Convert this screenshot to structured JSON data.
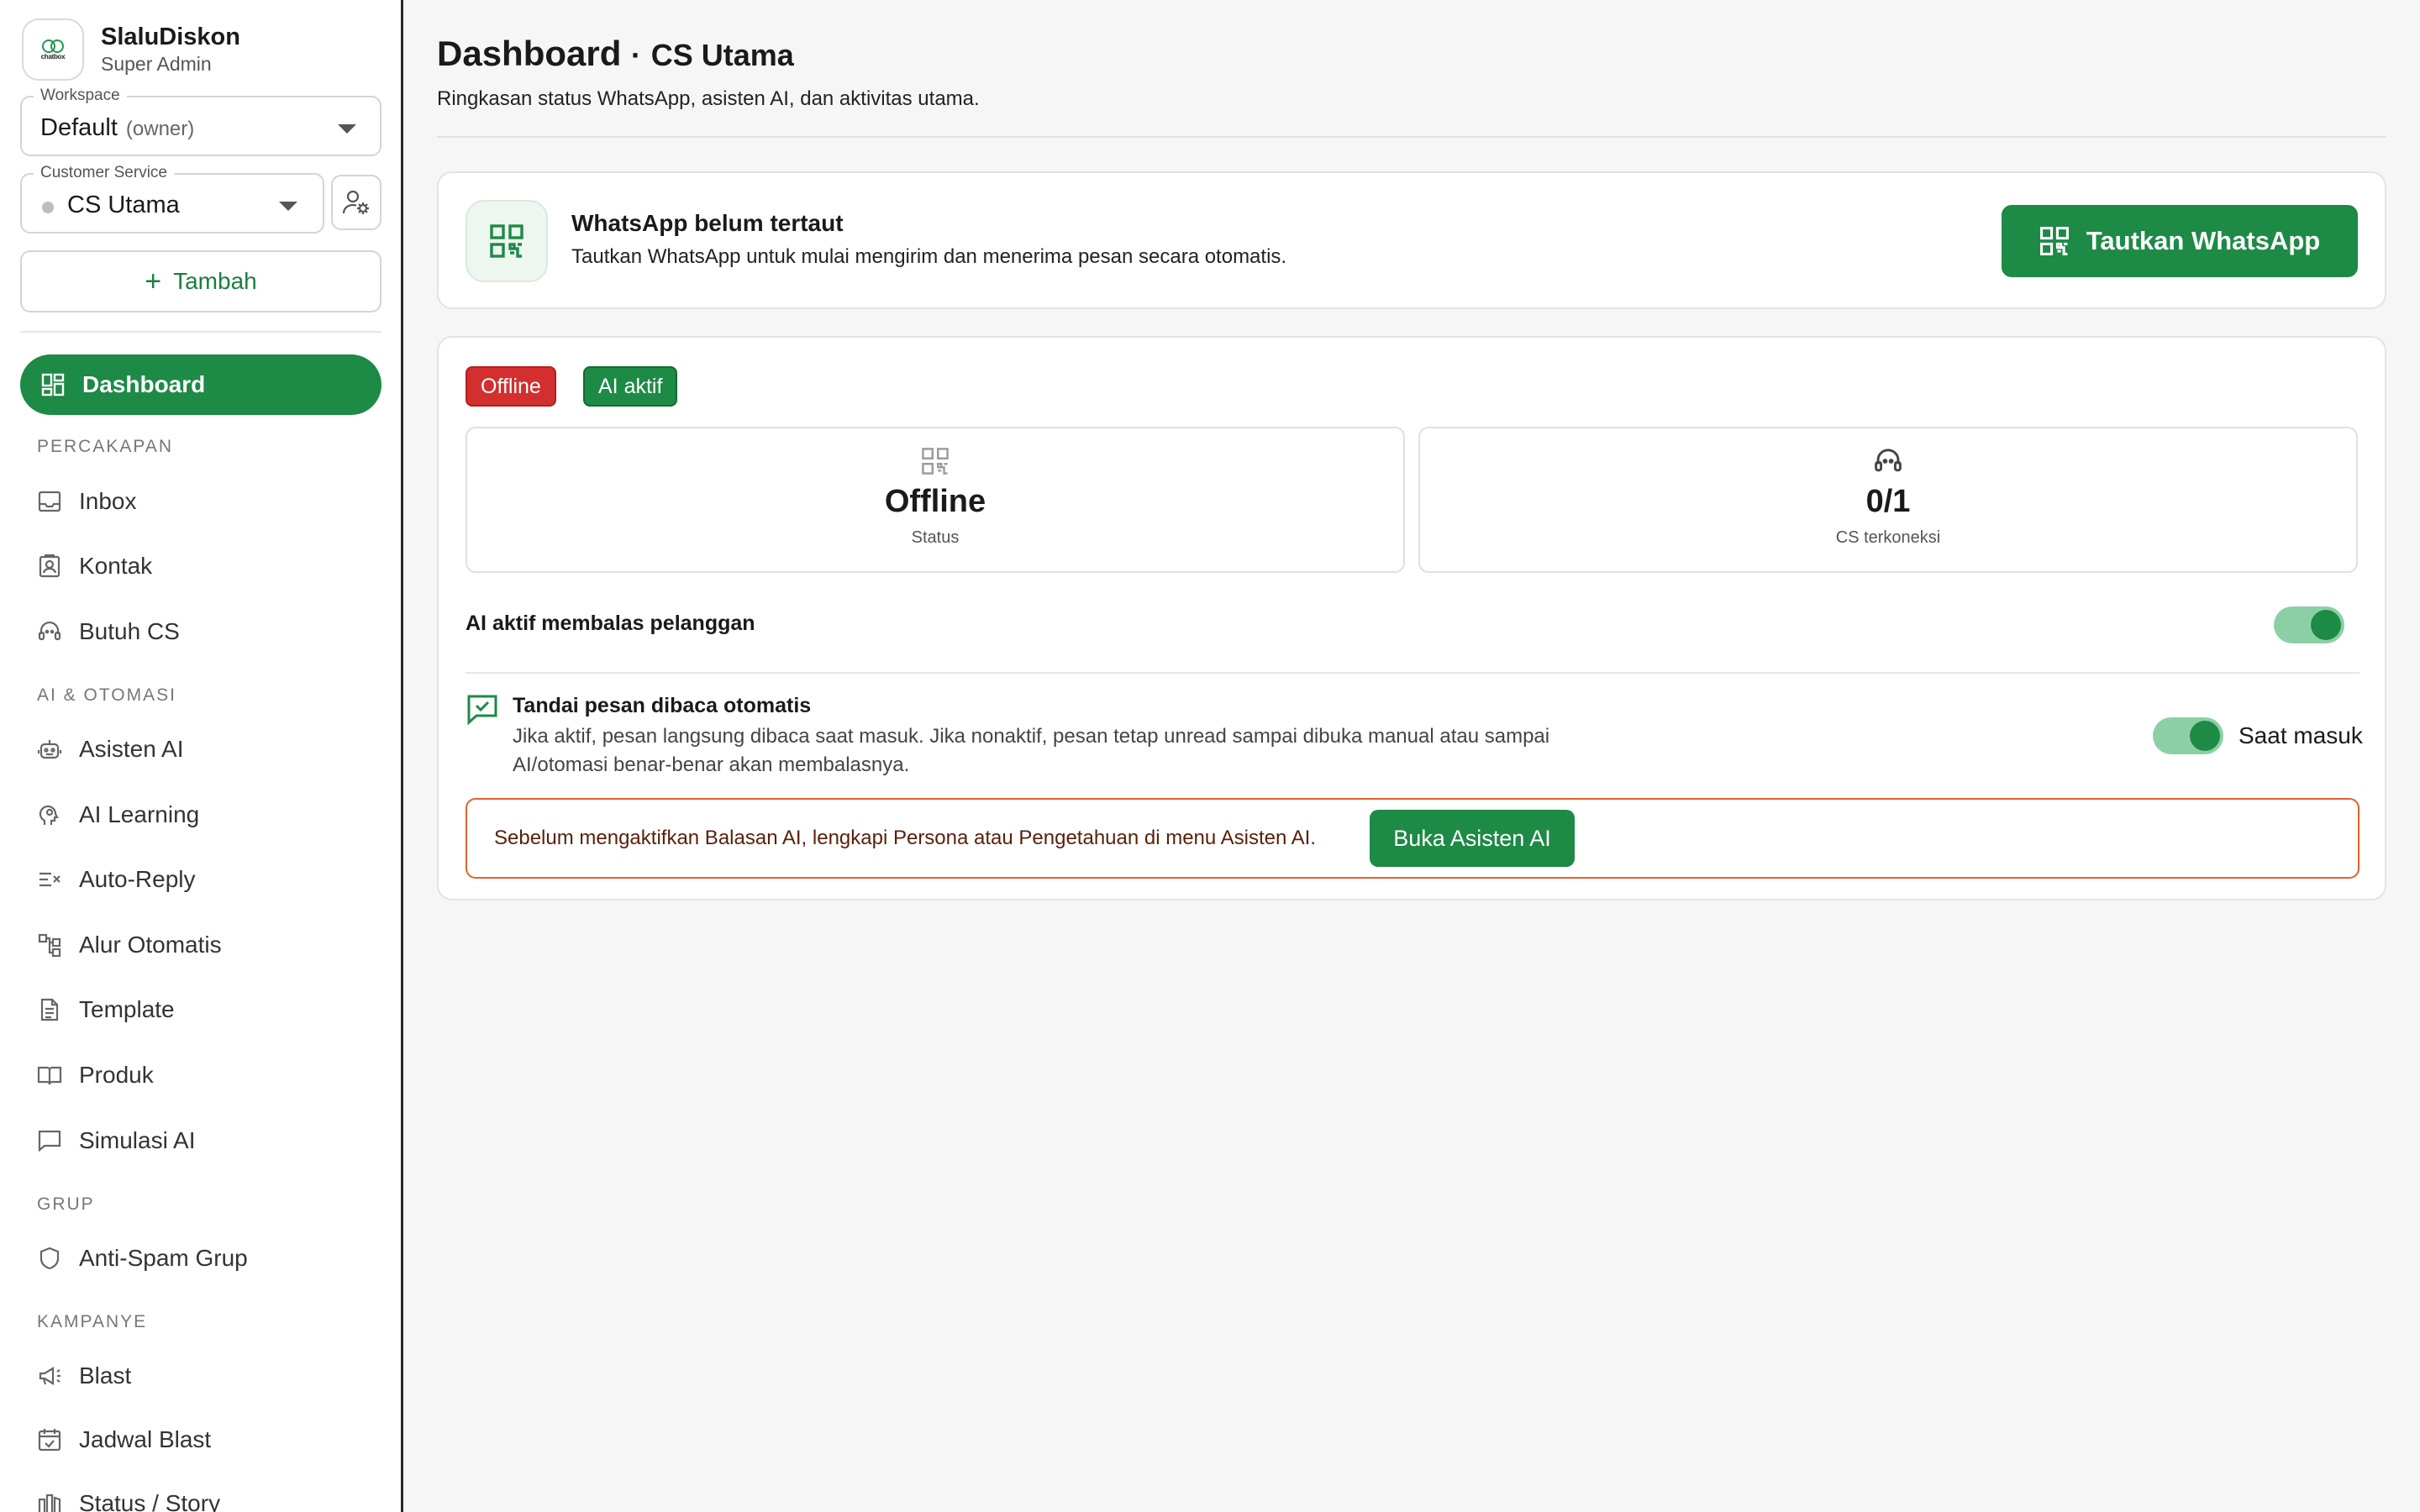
{
  "brand": {
    "name": "SlaluDiskon",
    "role": "Super Admin",
    "logo_text": "chatbox"
  },
  "workspace": {
    "legend": "Workspace",
    "value": "Default",
    "sub": "(owner)"
  },
  "customer_service": {
    "legend": "Customer Service",
    "value": "CS Utama"
  },
  "add_button": {
    "label": "Tambah"
  },
  "nav": {
    "dashboard": "Dashboard",
    "sections": {
      "percakapan": "PERCAKAPAN",
      "ai_otomasi": "AI & OTOMASI",
      "grup": "GRUP",
      "kampanye": "KAMPANYE"
    },
    "items": {
      "inbox": "Inbox",
      "kontak": "Kontak",
      "butuh_cs": "Butuh CS",
      "asisten_ai": "Asisten AI",
      "ai_learning": "AI Learning",
      "auto_reply": "Auto-Reply",
      "alur_otomatis": "Alur Otomatis",
      "template": "Template",
      "produk": "Produk",
      "simulasi_ai": "Simulasi AI",
      "anti_spam": "Anti-Spam Grup",
      "blast": "Blast",
      "jadwal_blast": "Jadwal Blast",
      "status_story": "Status / Story"
    }
  },
  "header": {
    "title": "Dashboard",
    "separator": "·",
    "context": "CS Utama",
    "subtitle": "Ringkasan status WhatsApp, asisten AI, dan aktivitas utama."
  },
  "whatsapp_card": {
    "title": "WhatsApp belum tertaut",
    "description": "Tautkan WhatsApp untuk mulai mengirim dan menerima pesan secara otomatis.",
    "button": "Tautkan WhatsApp"
  },
  "status": {
    "badges": {
      "offline": "Offline",
      "ai": "AI aktif"
    },
    "stats": [
      {
        "value": "Offline",
        "label": "Status"
      },
      {
        "value": "0/1",
        "label": "CS terkoneksi"
      }
    ],
    "ai_reply": {
      "label": "AI aktif membalas pelanggan",
      "enabled": true
    },
    "auto_read": {
      "title": "Tandai pesan dibaca otomatis",
      "description": "Jika aktif, pesan langsung dibaca saat masuk. Jika nonaktif, pesan tetap unread sampai dibuka manual atau sampai AI/otomasi benar-benar akan membalasnya.",
      "toggle_label": "Saat masuk",
      "enabled": true
    },
    "warning": {
      "text": "Sebelum mengaktifkan Balasan AI, lengkapi Persona atau Pengetahuan di menu Asisten AI.",
      "button": "Buka Asisten AI"
    }
  },
  "colors": {
    "accent": "#1d8a45",
    "danger": "#d32f2f",
    "warning_border": "#e2612b",
    "toggle_track": "#8dcfa5"
  }
}
